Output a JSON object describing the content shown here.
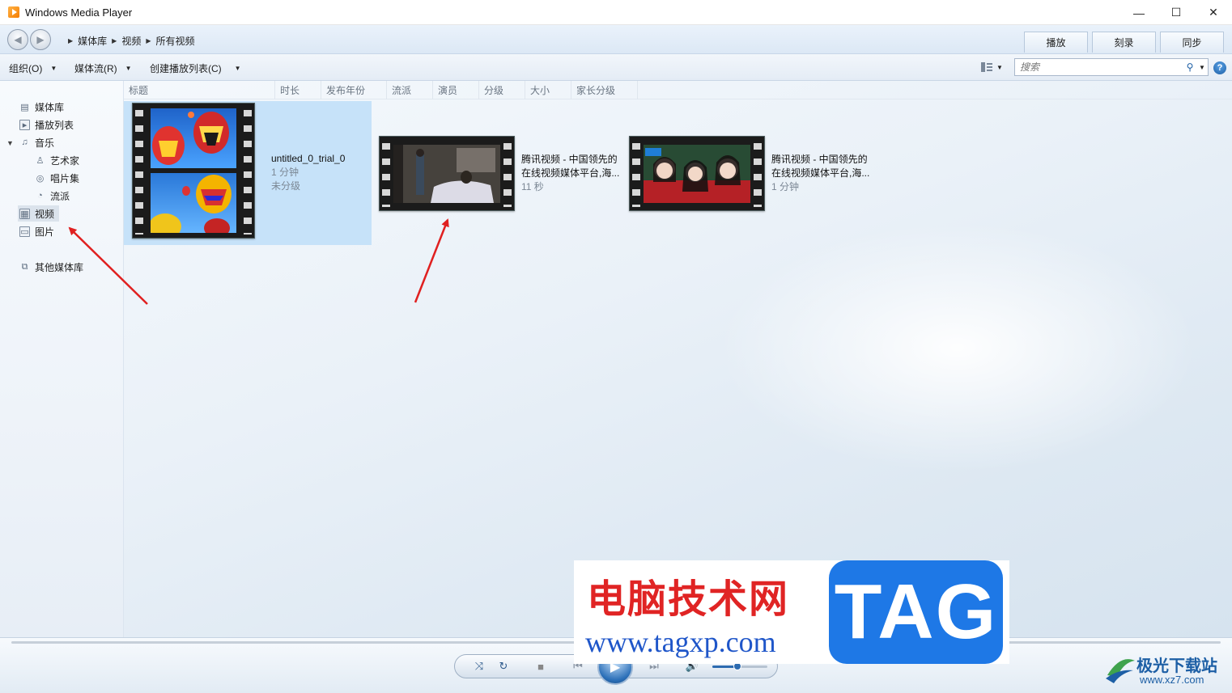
{
  "window": {
    "title": "Windows Media Player",
    "controls": [
      "—",
      "☐",
      "✕"
    ]
  },
  "breadcrumb": [
    "媒体库",
    "视频",
    "所有视频"
  ],
  "tabs": [
    "播放",
    "刻录",
    "同步"
  ],
  "toolbar": {
    "organize": "组织(O)",
    "stream": "媒体流(R)",
    "create_playlist": "创建播放列表(C)",
    "search_placeholder": "搜索"
  },
  "nav": {
    "library": "媒体库",
    "playlists": "播放列表",
    "music": "音乐",
    "artist": "艺术家",
    "album": "唱片集",
    "genre": "流派",
    "videos": "视频",
    "pictures": "图片",
    "other_libraries": "其他媒体库"
  },
  "columns": [
    "标题",
    "时长",
    "发布年份",
    "流派",
    "演员",
    "分级",
    "大小",
    "家长分级"
  ],
  "videos": [
    {
      "title": "untitled_0_trial_0",
      "duration": "1 分钟",
      "rating": "未分级"
    },
    {
      "title_line1": "腾讯视频 - 中国领先的",
      "title_line2": "在线视频媒体平台,海...",
      "duration": "11 秒"
    },
    {
      "title_line1": "腾讯视频 - 中国领先的",
      "title_line2": "在线视频媒体平台,海...",
      "duration": "1 分钟"
    }
  ],
  "player": {
    "volume_level": 0.45
  },
  "watermark": {
    "site_cn": "电脑技术网",
    "site_url": "www.tagxp.com",
    "tag": "TAG",
    "site2_cn": "极光下载站",
    "site2_url": "www.xz7.com"
  },
  "colors": {
    "selection": "#c6e2f9",
    "accent": "#1d5fa5",
    "arrow": "#e02020"
  }
}
